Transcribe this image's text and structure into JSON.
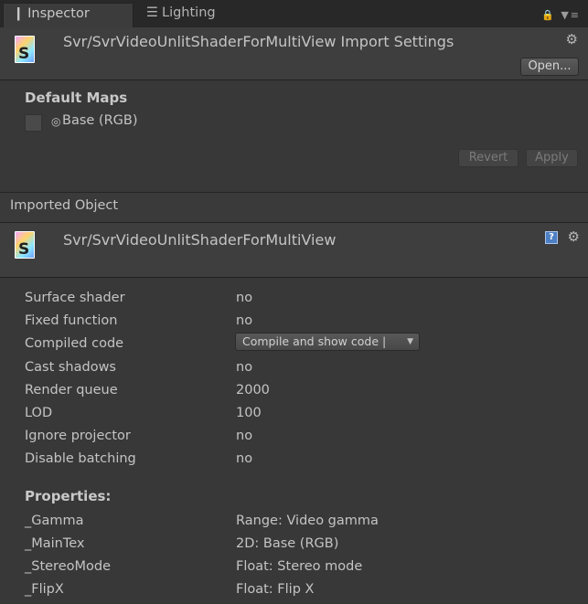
{
  "tabs": {
    "inspector": {
      "icon": "info-icon",
      "label": "Inspector"
    },
    "lighting": {
      "icon": "lighting-icon",
      "label": "Lighting"
    }
  },
  "import_header": {
    "title": "Svr/SvrVideoUnlitShaderForMultiView Import Settings",
    "icon_letter": "S",
    "open_button": "Open..."
  },
  "default_maps": {
    "title": "Default Maps",
    "base_label": "Base (RGB)"
  },
  "actions": {
    "revert": "Revert",
    "apply": "Apply"
  },
  "imported_object": {
    "section_label": "Imported Object",
    "title": "Svr/SvrVideoUnlitShaderForMultiView",
    "icon_letter": "S"
  },
  "info_rows": [
    {
      "key": "Surface shader",
      "value": "no"
    },
    {
      "key": "Fixed function",
      "value": "no"
    },
    {
      "key": "Compiled code",
      "value": "Compile and show code |"
    },
    {
      "key": "Cast shadows",
      "value": "no"
    },
    {
      "key": "Render queue",
      "value": "2000"
    },
    {
      "key": "LOD",
      "value": "100"
    },
    {
      "key": "Ignore projector",
      "value": "no"
    },
    {
      "key": "Disable batching",
      "value": "no"
    }
  ],
  "properties": {
    "title": "Properties:",
    "items": [
      {
        "key": "_Gamma",
        "value": "Range: Video gamma"
      },
      {
        "key": "_MainTex",
        "value": "2D: Base (RGB)"
      },
      {
        "key": "_StereoMode",
        "value": "Float: Stereo mode"
      },
      {
        "key": "_FlipX",
        "value": "Float: Flip X"
      }
    ]
  }
}
